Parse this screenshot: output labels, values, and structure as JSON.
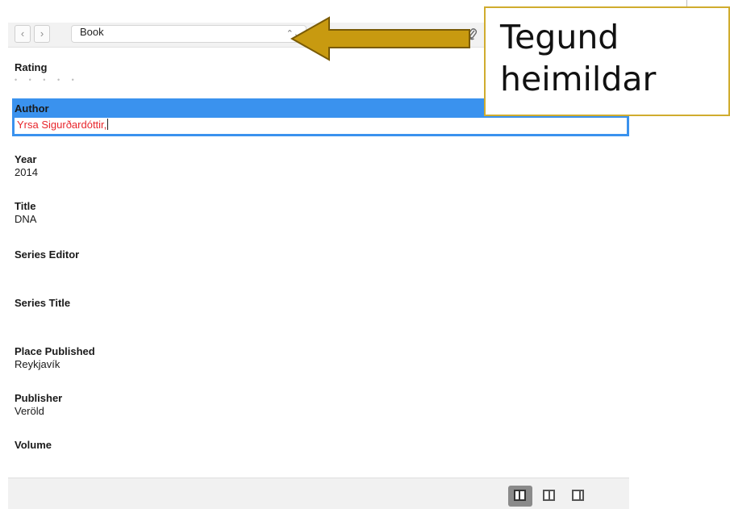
{
  "toolbar": {
    "back_icon": "chevron-left",
    "forward_icon": "chevron-right",
    "reference_type": "Book",
    "select_icon": "updown-chevron",
    "attach_icon": "paperclip"
  },
  "fields": {
    "rating": {
      "label": "Rating"
    },
    "author": {
      "label": "Author",
      "value": "Yrsa Sigurðardóttir,"
    },
    "year": {
      "label": "Year",
      "value": "2014"
    },
    "title": {
      "label": "Title",
      "value": "DNA"
    },
    "series_editor": {
      "label": "Series Editor"
    },
    "series_title": {
      "label": "Series Title"
    },
    "place_published": {
      "label": "Place Published",
      "value": "Reykjavík"
    },
    "publisher": {
      "label": "Publisher",
      "value": "Veröld"
    },
    "volume": {
      "label": "Volume"
    }
  },
  "callout": {
    "line1": "Tegund",
    "line2": "heimildar",
    "border_color": "#d0ac2e",
    "arrow_color": "#c89a10"
  },
  "colors": {
    "selection": "#3a92ee",
    "author_text": "#e8262c"
  }
}
